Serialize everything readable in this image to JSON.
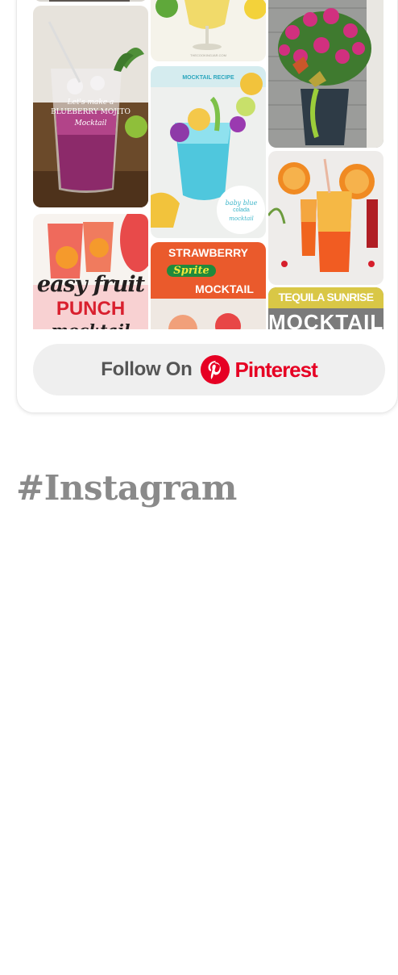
{
  "pinterest_widget": {
    "pins": [
      {
        "name": "blueberry-mojito",
        "lines": [
          "Let's make a",
          "BLUEBERRY MOJITO",
          "Mocktail"
        ]
      },
      {
        "name": "lemonade-glass",
        "caption": "THECOOKINGJAR.COM"
      },
      {
        "name": "flower-planter"
      },
      {
        "name": "baby-blue-colada",
        "banner": "MOCKTAIL RECIPE",
        "corner": [
          "baby blue",
          "colada",
          "mocktail"
        ]
      },
      {
        "name": "tequila-sunrise-drink"
      },
      {
        "name": "fruit-punch",
        "lines": [
          "easy fruit",
          "PUNCH",
          "mocktail"
        ]
      },
      {
        "name": "strawberry-sprite",
        "lines": [
          "STRAWBERRY",
          "Sprite",
          "MOCKTAIL"
        ]
      },
      {
        "name": "tequila-sunrise-title",
        "lines": [
          "TEQUILA SUNRISE",
          "MOCKTAIL"
        ]
      }
    ],
    "follow_button": {
      "prefix": "Follow On",
      "brand": "Pinterest",
      "icon": "pinterest-logo-icon"
    }
  },
  "instagram_section": {
    "heading": "#Instagram"
  },
  "colors": {
    "pinterest_red": "#e60023",
    "button_bg": "#efefef",
    "heading_gray": "#8a8a8a"
  }
}
